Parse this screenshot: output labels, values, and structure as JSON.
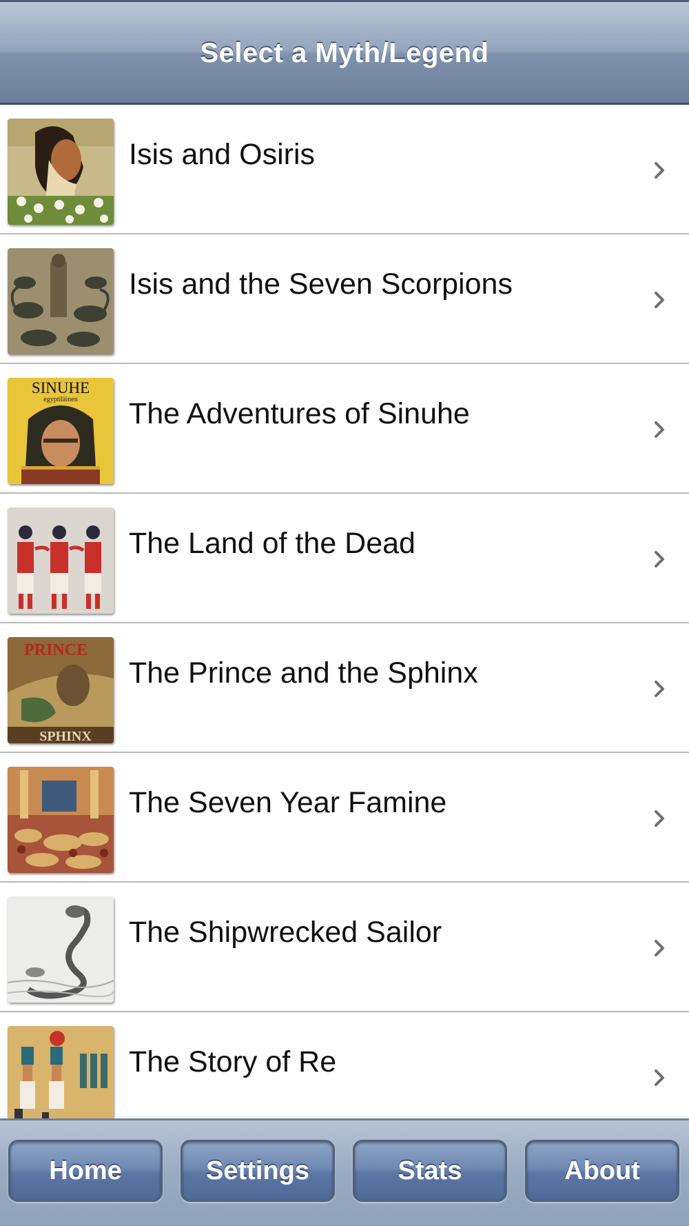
{
  "header": {
    "title": "Select a Myth/Legend"
  },
  "list": {
    "items": [
      {
        "label": "Isis and Osiris",
        "thumbnail": "lovers-with-flowers-image"
      },
      {
        "label": "Isis and the Seven Scorpions",
        "thumbnail": "scorpions-image"
      },
      {
        "label": "The Adventures of Sinuhe",
        "thumbnail": "sinuhe-book-cover-image",
        "cover_text": "SINUHE",
        "cover_subtext": "egyptiläinen"
      },
      {
        "label": "The Land of the Dead",
        "thumbnail": "egyptian-gods-wall-painting-image"
      },
      {
        "label": "The Prince and the Sphinx",
        "thumbnail": "prince-sphinx-cover-image",
        "cover_text": "PRINCE",
        "cover_subtext": "SPHINX"
      },
      {
        "label": "The Seven Year Famine",
        "thumbnail": "famine-scene-image"
      },
      {
        "label": "The Shipwrecked Sailor",
        "thumbnail": "serpent-sketch-image"
      },
      {
        "label": "The Story of Re",
        "thumbnail": "re-wall-painting-image"
      }
    ],
    "chevron_icon": "chevron-right-icon"
  },
  "tabbar": {
    "home": "Home",
    "settings": "Settings",
    "stats": "Stats",
    "about": "About"
  },
  "colors": {
    "nav_accent": "#6b7f9c",
    "button": "#5b76a3",
    "separator": "#b9b9b9"
  }
}
